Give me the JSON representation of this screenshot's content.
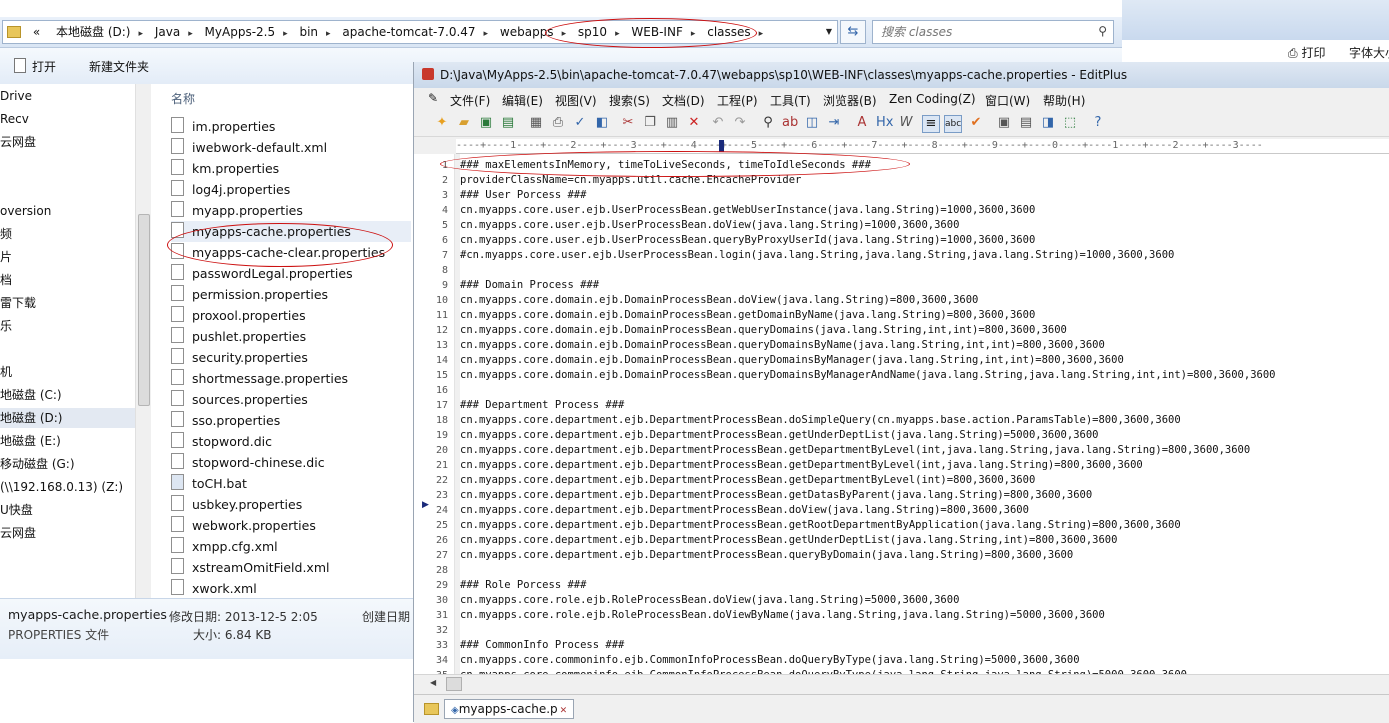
{
  "explorer": {
    "breadcrumb_prefix": "«",
    "breadcrumb": [
      "本地磁盘 (D:)",
      "Java",
      "MyApps-2.5",
      "bin",
      "apache-tomcat-7.0.47",
      "webapps",
      "sp10",
      "WEB-INF",
      "classes"
    ],
    "search_placeholder": "搜索 classes",
    "toolbar": {
      "open_label": "打开",
      "new_folder_label": "新建文件夹"
    },
    "nav_items": [
      "Drive",
      "Recv",
      "云网盘",
      "oversion",
      "频",
      "片",
      "档",
      "雷下载",
      "乐",
      "机",
      "地磁盘 (C:)",
      "地磁盘 (D:)",
      "地磁盘 (E:)",
      "移动磁盘 (G:)",
      "(\\\\192.168.0.13) (Z:)",
      "U快盘",
      "云网盘"
    ],
    "column_header": "名称",
    "files": [
      "im.properties",
      "iwebwork-default.xml",
      "km.properties",
      "log4j.properties",
      "myapp.properties",
      "myapps-cache.properties",
      "myapps-cache-clear.properties",
      "passwordLegal.properties",
      "permission.properties",
      "proxool.properties",
      "pushlet.properties",
      "security.properties",
      "shortmessage.properties",
      "sources.properties",
      "sso.properties",
      "stopword.dic",
      "stopword-chinese.dic",
      "toCH.bat",
      "usbkey.properties",
      "webwork.properties",
      "xmpp.cfg.xml",
      "xstreamOmitField.xml",
      "xwork.xml"
    ],
    "details": {
      "file_name": "myapps-cache.properties",
      "modified_label": "修改日期: 2013-12-5 2:05",
      "created_label": "创建日期",
      "file_type": "PROPERTIES 文件",
      "size_label": "大小: 6.84 KB"
    }
  },
  "browser_strip": {
    "print_label": "打印",
    "font_label": "字体大小"
  },
  "editplus": {
    "title": "D:\\Java\\MyApps-2.5\\bin\\apache-tomcat-7.0.47\\webapps\\sp10\\WEB-INF\\classes\\myapps-cache.properties - EditPlus",
    "menu": [
      "文件(F)",
      "编辑(E)",
      "视图(V)",
      "搜索(S)",
      "文档(D)",
      "工程(P)",
      "工具(T)",
      "浏览器(B)",
      "Zen Coding(Z)",
      "窗口(W)",
      "帮助(H)"
    ],
    "ruler": "----+----1----+----2----+----3----+----4----+----5----+----6----+----7----+----8----+----9----+----0----+----1----+----2----+----3----",
    "lines": [
      "### maxElementsInMemory, timeToLiveSeconds, timeToIdleSeconds ###",
      "providerClassName=cn.myapps.util.cache.EhcacheProvider",
      "### User Porcess ###",
      "cn.myapps.core.user.ejb.UserProcessBean.getWebUserInstance(java.lang.String)=1000,3600,3600",
      "cn.myapps.core.user.ejb.UserProcessBean.doView(java.lang.String)=1000,3600,3600",
      "cn.myapps.core.user.ejb.UserProcessBean.queryByProxyUserId(java.lang.String)=1000,3600,3600",
      "#cn.myapps.core.user.ejb.UserProcessBean.login(java.lang.String,java.lang.String,java.lang.String)=1000,3600,3600",
      "",
      "### Domain Process ###",
      "cn.myapps.core.domain.ejb.DomainProcessBean.doView(java.lang.String)=800,3600,3600",
      "cn.myapps.core.domain.ejb.DomainProcessBean.getDomainByName(java.lang.String)=800,3600,3600",
      "cn.myapps.core.domain.ejb.DomainProcessBean.queryDomains(java.lang.String,int,int)=800,3600,3600",
      "cn.myapps.core.domain.ejb.DomainProcessBean.queryDomainsByName(java.lang.String,int,int)=800,3600,3600",
      "cn.myapps.core.domain.ejb.DomainProcessBean.queryDomainsByManager(java.lang.String,int,int)=800,3600,3600",
      "cn.myapps.core.domain.ejb.DomainProcessBean.queryDomainsByManagerAndName(java.lang.String,java.lang.String,int,int)=800,3600,3600",
      "",
      "### Department Process ###",
      "cn.myapps.core.department.ejb.DepartmentProcessBean.doSimpleQuery(cn.myapps.base.action.ParamsTable)=800,3600,3600",
      "cn.myapps.core.department.ejb.DepartmentProcessBean.getUnderDeptList(java.lang.String)=5000,3600,3600",
      "cn.myapps.core.department.ejb.DepartmentProcessBean.getDepartmentByLevel(int,java.lang.String,java.lang.String)=800,3600,3600",
      "cn.myapps.core.department.ejb.DepartmentProcessBean.getDepartmentByLevel(int,java.lang.String)=800,3600,3600",
      "cn.myapps.core.department.ejb.DepartmentProcessBean.getDepartmentByLevel(int)=800,3600,3600",
      "cn.myapps.core.department.ejb.DepartmentProcessBean.getDatasByParent(java.lang.String)=800,3600,3600",
      "cn.myapps.core.department.ejb.DepartmentProcessBean.doView(java.lang.String)=800,3600,3600",
      "cn.myapps.core.department.ejb.DepartmentProcessBean.getRootDepartmentByApplication(java.lang.String)=800,3600,3600",
      "cn.myapps.core.department.ejb.DepartmentProcessBean.getUnderDeptList(java.lang.String,int)=800,3600,3600",
      "cn.myapps.core.department.ejb.DepartmentProcessBean.queryByDomain(java.lang.String)=800,3600,3600",
      "",
      "### Role Porcess ###",
      "cn.myapps.core.role.ejb.RoleProcessBean.doView(java.lang.String)=5000,3600,3600",
      "cn.myapps.core.role.ejb.RoleProcessBean.doViewByName(java.lang.String,java.lang.String)=5000,3600,3600",
      "",
      "### CommonInfo Process ###",
      "cn.myapps.core.commoninfo.ejb.CommonInfoProcessBean.doQueryByType(java.lang.String)=5000,3600,3600",
      "cn.myapps.core.commoninfo.ejb.CommonInfoProcessBean.doQueryByType(java.lang.String,java.lang.String)=5000,3600,3600"
    ],
    "tab_label": "myapps-cache.p"
  }
}
